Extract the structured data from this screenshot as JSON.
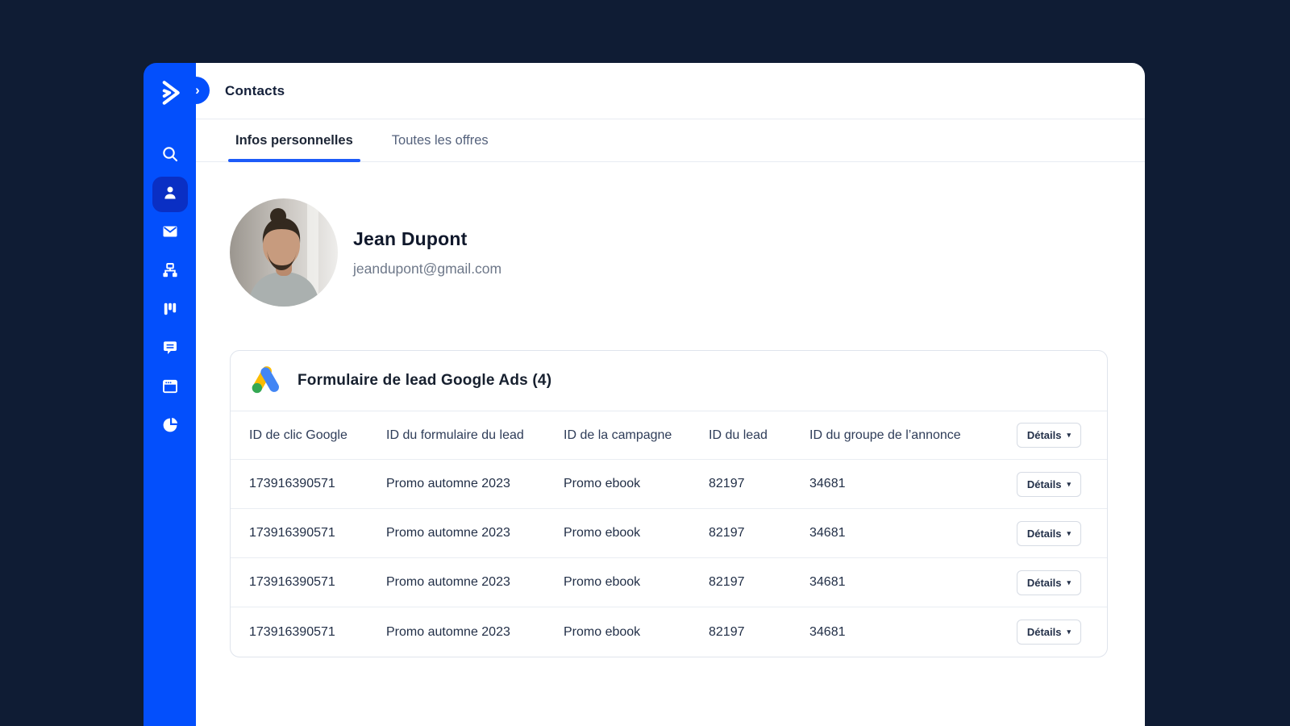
{
  "app": {
    "page_title": "Contacts",
    "collapse_icon": "»"
  },
  "sidebar": {
    "items": [
      {
        "name": "search",
        "active": false
      },
      {
        "name": "contacts",
        "active": true
      },
      {
        "name": "email-campaigns",
        "active": false
      },
      {
        "name": "automations",
        "active": false
      },
      {
        "name": "pipelines",
        "active": false
      },
      {
        "name": "conversations",
        "active": false
      },
      {
        "name": "forms",
        "active": false
      },
      {
        "name": "reports",
        "active": false
      }
    ]
  },
  "tabs": {
    "personal": "Infos personnelles",
    "offers": "Toutes les offres"
  },
  "contact": {
    "name": "Jean Dupont",
    "email": "jeandupont@gmail.com"
  },
  "leadform": {
    "title": "Formulaire de lead Google Ads (4)",
    "columns": [
      "ID de clic Google",
      "ID du formulaire du lead",
      "ID de la campagne",
      "ID du lead",
      "ID du groupe de l’annonce"
    ],
    "details_label": "Détails",
    "caret_icon": "▾",
    "rows": [
      [
        "173916390571",
        "Promo automne 2023",
        "Promo ebook",
        "82197",
        "34681"
      ],
      [
        "173916390571",
        "Promo automne 2023",
        "Promo ebook",
        "82197",
        "34681"
      ],
      [
        "173916390571",
        "Promo automne 2023",
        "Promo ebook",
        "82197",
        "34681"
      ],
      [
        "173916390571",
        "Promo automne 2023",
        "Promo ebook",
        "82197",
        "34681"
      ]
    ]
  },
  "colors": {
    "frame_navy": "#0f1c34",
    "sidebar_blue": "#034ffc",
    "active_item_blue": "#0a2fc4",
    "accent_blue": "#1d5bf8",
    "google_yellow": "#fbbc04",
    "google_blue": "#4285f4",
    "google_green": "#34a853"
  }
}
